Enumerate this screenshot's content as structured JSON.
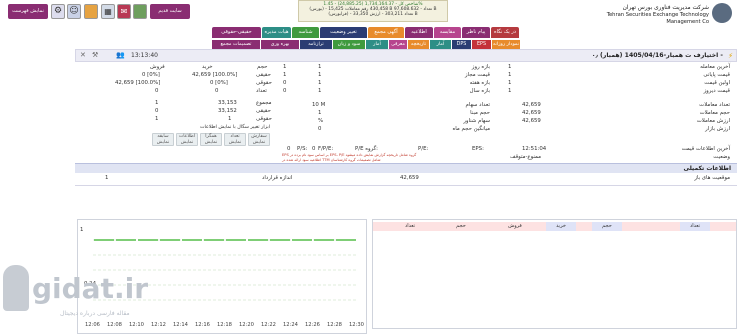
{
  "header": {
    "company_fa": "شرکت مدیریت فناوری بورس تهران",
    "company_en": "Tehran Securities Exchange Technology Management Co",
    "index_lines": [
      "شاخص کل - 1,734,164.37 (24,885.25) - 1.45%",
      "(بورس) - 430,458 رقم معاملات 15,425 B تعداد - 97,608.632 B",
      "(فرابورس) - تعداد 303,211 - ارزش 33,350 B"
    ],
    "buttons": {
      "old_site": "سایت قدیم",
      "watchlist": "نمایش فهرست"
    }
  },
  "tabs": {
    "row1": [
      "در یک نگاه",
      "پیام ناظر",
      "مقایسه",
      "اطلاعیه",
      "آگهی مجمع",
      "تغییر وضعیت",
      "شناسه",
      "هیات مدیره",
      "حقیقی-حقوقی"
    ],
    "row2": [
      "نمودار روزانه",
      "EPS",
      "DPS",
      "آمار",
      "تاریخچه",
      "معرفی",
      "آمار شرکت",
      "سود و زیان",
      "ترازنامه",
      "بهره وری",
      "تصمیمات مجمع"
    ]
  },
  "title": {
    "symbol": "اختیارف ت همبار-1405/04/16 (همبار) ۰٫ -",
    "time": "13:13:40"
  },
  "left_stats": [
    {
      "label": "آخرین معامله",
      "value": "1"
    },
    {
      "label": "قیمت پایانی",
      "value": "1"
    },
    {
      "label": "اولین قیمت",
      "value": "1"
    },
    {
      "label": "قیمت دیروز",
      "value": "1"
    },
    {
      "label": "تعداد معاملات",
      "value": "42,659"
    },
    {
      "label": "حجم معاملات",
      "value": "42,659"
    },
    {
      "label": "ارزش معاملات",
      "value": "42,659"
    },
    {
      "label": "ارزش بازار",
      "value": ""
    }
  ],
  "range_labels": [
    {
      "label": "بازه روز",
      "value": "1"
    },
    {
      "label": "قیمت مجاز",
      "value": "1"
    },
    {
      "label": "بازه هفته",
      "value": "1"
    },
    {
      "label": "بازه سال",
      "value": "1"
    }
  ],
  "mid_stats": [
    {
      "label": "تعداد سهام",
      "value": "10 M"
    },
    {
      "label": "حجم مبنا",
      "value": "1"
    },
    {
      "label": "سهام شناور",
      "value": "%"
    },
    {
      "label": "میانگین حجم ماه",
      "value": "0"
    }
  ],
  "legal_table": {
    "headers": [
      "فروش",
      "خرید",
      "",
      ""
    ],
    "rows": [
      {
        "c1": "فروش",
        "c2": "خرید",
        "c3": "حجم",
        "c4": "1",
        "c5": "1"
      },
      {
        "c1": "0 [0%]",
        "c2": "42,659 [100.0%]",
        "c3": "حقیقی",
        "c4": "1",
        "c5": "1"
      },
      {
        "c1": "42,659 [100.0%]",
        "c2": "0 [0%]",
        "c3": "حقوقی",
        "c4": "0",
        "c5": "0"
      },
      {
        "c1": "0",
        "c2": "0",
        "c3": "تعداد",
        "c4": "0",
        "c5": "0"
      }
    ],
    "rows2": [
      {
        "c1": "1",
        "c2": "33,153",
        "c3": "مجموع"
      },
      {
        "c1": "0",
        "c2": "33,152",
        "c3": "حقیقی"
      },
      {
        "c1": "1",
        "c2": "1",
        "c3": "حقوقی"
      }
    ]
  },
  "tools": {
    "caption": "ابزار تغییر سگال با نمایش اطلاعات",
    "buttons": [
      "سفارش نمایش",
      "تعداد نمایش",
      "همگرا نمایش",
      "اطلاعات نمایش",
      "سابقه نمایش"
    ]
  },
  "eps_row": {
    "last_update_label": "آخرین اطلاعات قیمت",
    "last_update_value": "12:51:04",
    "status_label": "وضعیت",
    "status_value": "ممنوع-متوقف",
    "eps": "EPS:",
    "pe": "P/E:",
    "group_pe": "P/E گروه:",
    "fp_e": "F/P/E:",
    "ps": "P/S:",
    "zero": "0",
    "zero2": "0",
    "note1": "EPS بر اساس سود نام برده در EPS، P/E گروه شامل تاریخچه گزارش نمایش داده میشود",
    "note2": "اطلاعیه سود ارائه شده در TTM شامل تصمیمات گروه کارشناسان"
  },
  "tech_info": {
    "title": "اطلاعات تکمیلی",
    "position_label": "موقعیت های باز",
    "position_value": "42,659",
    "contract_label": "اندازه قرارداد",
    "contract_value": "1"
  },
  "orderbook": {
    "headers": [
      "تعداد",
      "حجم",
      "خرید",
      "فروش",
      "حجم",
      "تعداد"
    ]
  },
  "chart_data": {
    "type": "line",
    "x": [
      "12:06",
      "12:08",
      "12:10",
      "12:12",
      "12:14",
      "12:16",
      "12:18",
      "12:20",
      "12:22",
      "12:24",
      "12:26",
      "12:28",
      "12:30"
    ],
    "series": [
      {
        "values": [
          1,
          1,
          1,
          1,
          1,
          1,
          1,
          1,
          1,
          1,
          1,
          1,
          1
        ]
      }
    ],
    "yticks": [
      "1",
      "0.24"
    ],
    "ylim": [
      0,
      1.2
    ],
    "grid": true
  },
  "watermark": {
    "brand": "gidat.ir",
    "sub": "مقاله فارسی درباره دیجیتال"
  },
  "colors": {
    "accent_purple": "#8a2d72",
    "green": "#3f9a3e",
    "orange": "#e88b2c",
    "teal": "#2d8e86",
    "red": "#c4323a",
    "navy": "#2b3c73"
  }
}
